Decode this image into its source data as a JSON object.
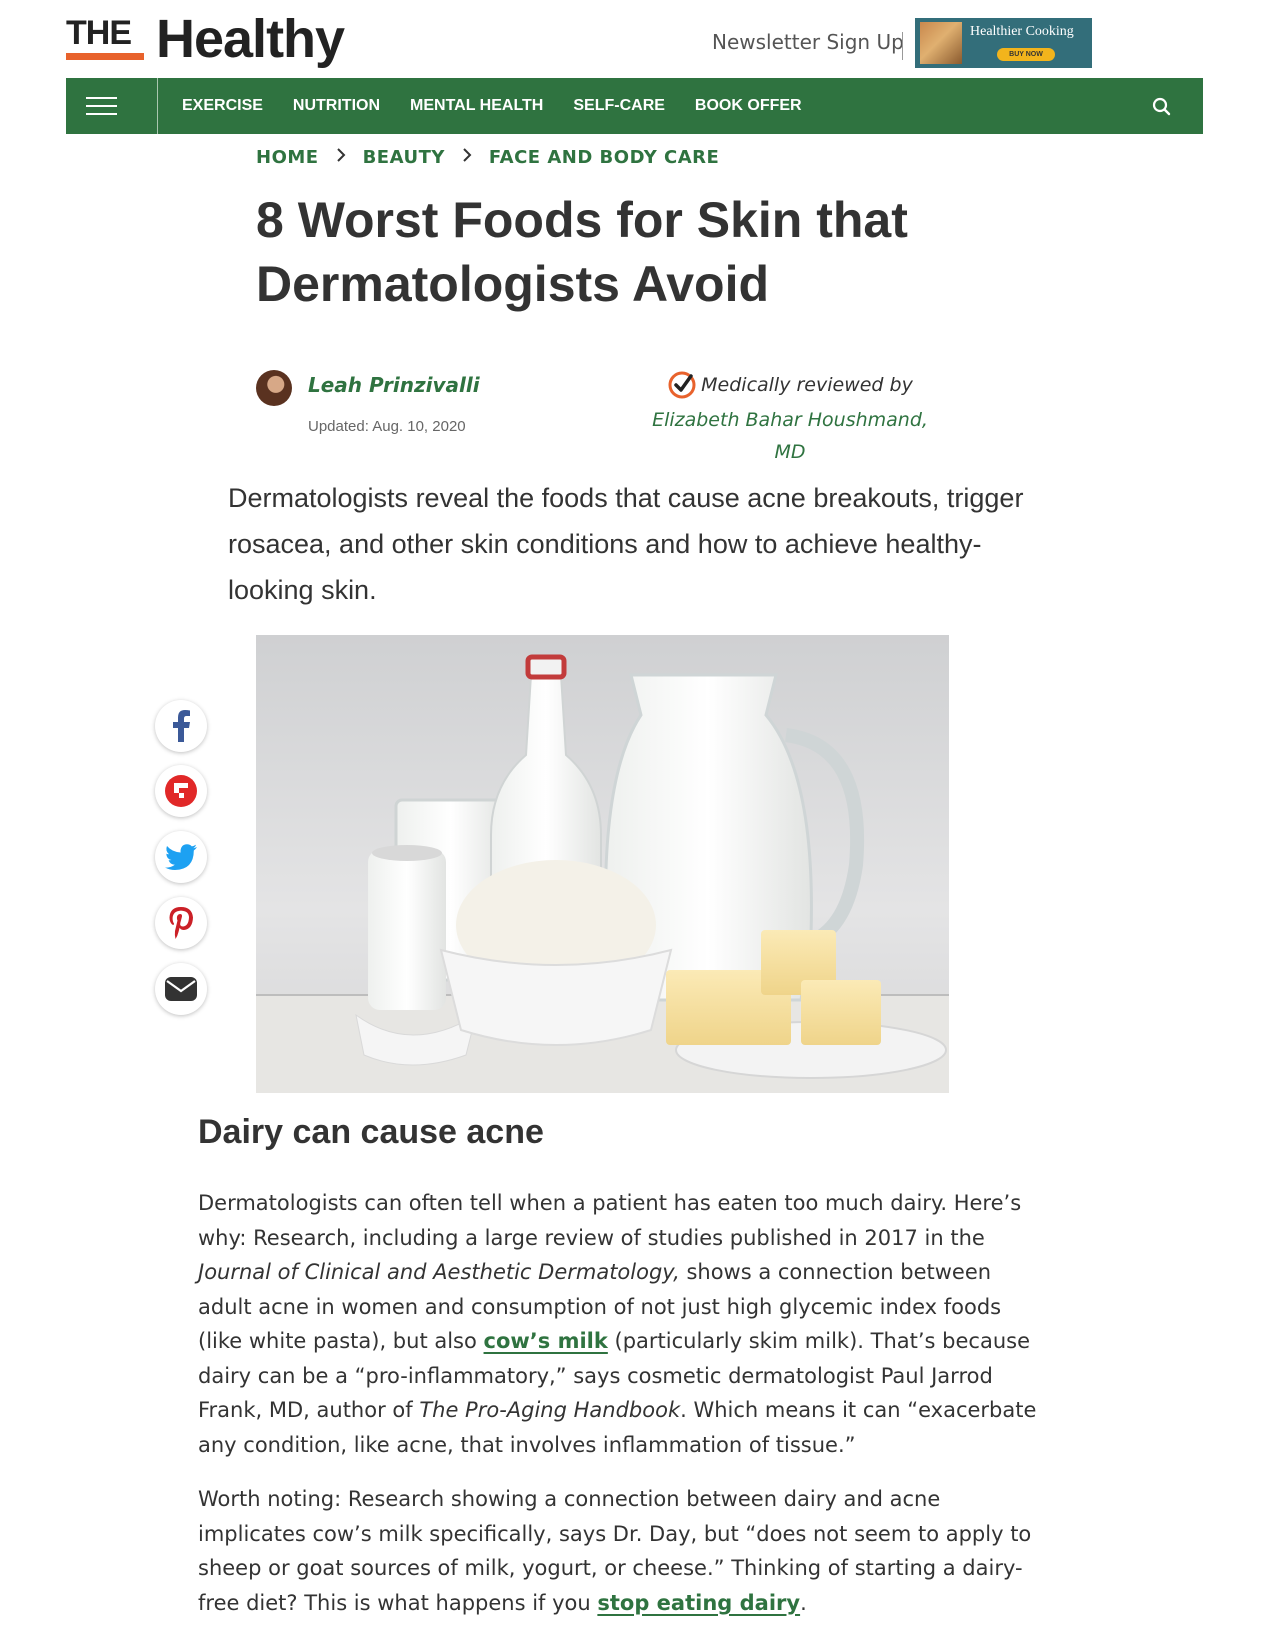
{
  "header": {
    "logo_the": "THE",
    "logo_healthy": "Healthy",
    "newsletter": "Newsletter Sign Up",
    "ad": {
      "title": "Healthier Cooking",
      "cta": "BUY NOW"
    }
  },
  "nav": {
    "items": [
      "EXERCISE",
      "NUTRITION",
      "MENTAL HEALTH",
      "SELF-CARE",
      "BOOK OFFER"
    ],
    "menu_icon": "hamburger-icon",
    "search_icon": "search-icon",
    "color": "#2f7340"
  },
  "breadcrumb": [
    "HOME",
    "BEAUTY",
    "FACE AND BODY CARE"
  ],
  "article": {
    "title": "8 Worst Foods for Skin that Dermatologists Avoid",
    "author": "Leah Prinzivalli",
    "updated": "Updated: Aug. 10, 2020",
    "reviewed_label": "Medically reviewed by",
    "reviewer": "Elizabeth Bahar Houshmand, MD",
    "dek": "Dermatologists reveal the foods that cause acne breakouts, trigger rosacea, and other skin conditions and how to achieve healthy-looking skin.",
    "hero_alt": "dairy products photo"
  },
  "share": [
    "facebook-icon",
    "flipboard-icon",
    "twitter-icon",
    "pinterest-icon",
    "email-icon"
  ],
  "section": {
    "heading": "Dairy can cause acne",
    "p1": {
      "t1": "Dermatologists can often tell when a patient has eaten too much dairy. Here’s why: Research, including a large review of studies published in 2017 in the ",
      "i1": "Journal of Clinical and Aesthetic Dermatology,",
      "t2": " shows a connection between adult acne in women and consumption of not just high glycemic index foods (like white pasta), but also ",
      "link": "cow’s milk",
      "t3": " (particularly skim milk). That’s because dairy can be a “pro-inflammatory,” says cosmetic dermatologist Paul Jarrod Frank, MD, author of ",
      "i2": "The Pro-Aging Handbook",
      "t4": ". Which means it can “exacerbate any condition, like acne, that involves inflammation of tissue.”"
    },
    "p2": {
      "t1": "Worth noting: Research showing a connection between dairy and acne implicates cow’s milk specifically, says Dr. Day, but “does not seem to apply to sheep or goat sources of milk, yogurt, or cheese.” Thinking of starting a dairy-free diet? This is what happens if you ",
      "link": "stop eating dairy",
      "t2": "."
    }
  }
}
